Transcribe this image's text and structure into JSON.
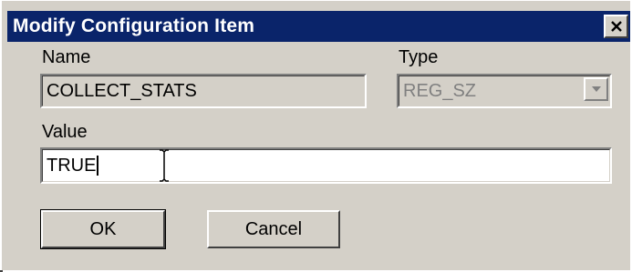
{
  "window": {
    "title": "Modify Configuration Item",
    "title_bar_color": "#0a246a",
    "face_color": "#d4d0c8"
  },
  "form": {
    "name_label": "Name",
    "name_value": "COLLECT_STATS",
    "type_label": "Type",
    "type_value": "REG_SZ",
    "value_label": "Value",
    "value_text": "TRUE"
  },
  "buttons": {
    "ok_label": "OK",
    "cancel_label": "Cancel"
  },
  "icons": {
    "close": "close-icon",
    "dropdown": "chevron-down-icon",
    "cursor": "text-cursor-icon"
  }
}
